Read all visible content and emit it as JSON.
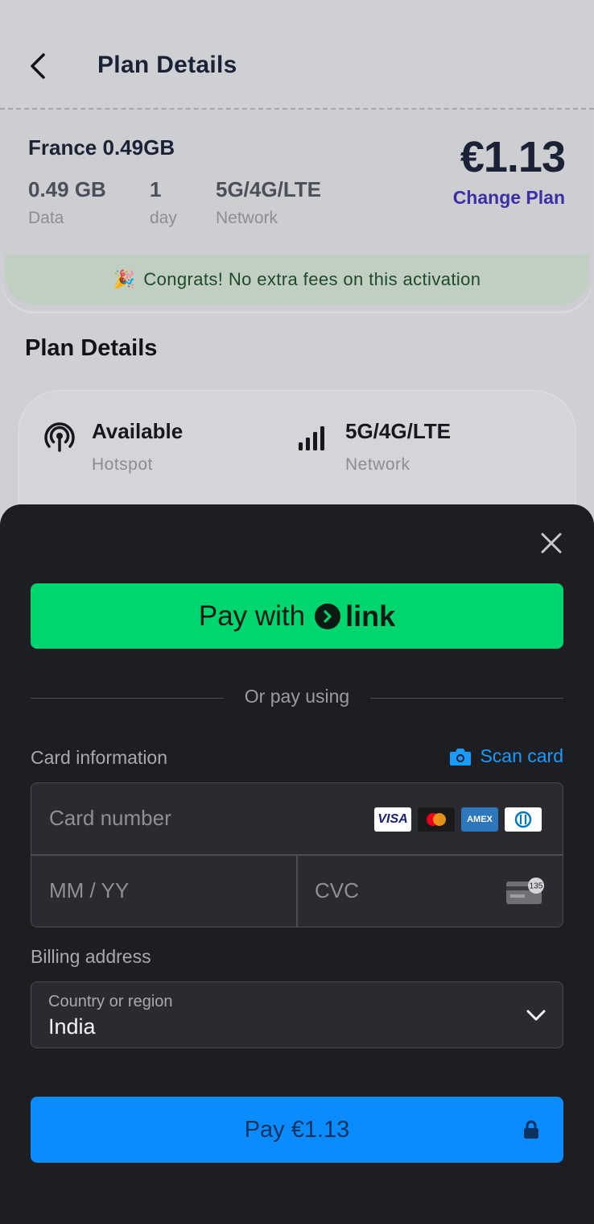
{
  "header": {
    "title": "Plan Details"
  },
  "plan": {
    "name": "France 0.49GB",
    "price": "€1.13",
    "change_plan": "Change Plan",
    "stats": [
      {
        "value": "0.49 GB",
        "label": "Data"
      },
      {
        "value": "1",
        "label": "day"
      },
      {
        "value": "5G/4G/LTE",
        "label": "Network"
      }
    ],
    "congrats": "Congrats! No extra fees on this activation",
    "congrats_icon": "🎉"
  },
  "details": {
    "section_title": "Plan Details",
    "items": [
      {
        "value": "Available",
        "label": "Hotspot",
        "icon": "hotspot-icon"
      },
      {
        "value": "5G/4G/LTE",
        "label": "Network",
        "icon": "signal-bars-icon"
      }
    ]
  },
  "payment_sheet": {
    "link_button": {
      "prefix": "Pay with",
      "brand": "link"
    },
    "or_text": "Or pay using",
    "card_info_label": "Card information",
    "scan_card": "Scan card",
    "card_number_placeholder": "Card number",
    "expiry_placeholder": "MM / YY",
    "cvc_placeholder": "CVC",
    "cvc_badge": "135",
    "card_brands": [
      "VISA",
      "mastercard",
      "AMEX",
      "diners"
    ],
    "billing_label": "Billing address",
    "country_label": "Country or region",
    "country_value": "India",
    "pay_button": "Pay €1.13"
  },
  "colors": {
    "link_green": "#00d66f",
    "pay_blue": "#0a8cff",
    "accent_purple": "#3c2fa6",
    "sheet_bg": "#1d1e22"
  }
}
